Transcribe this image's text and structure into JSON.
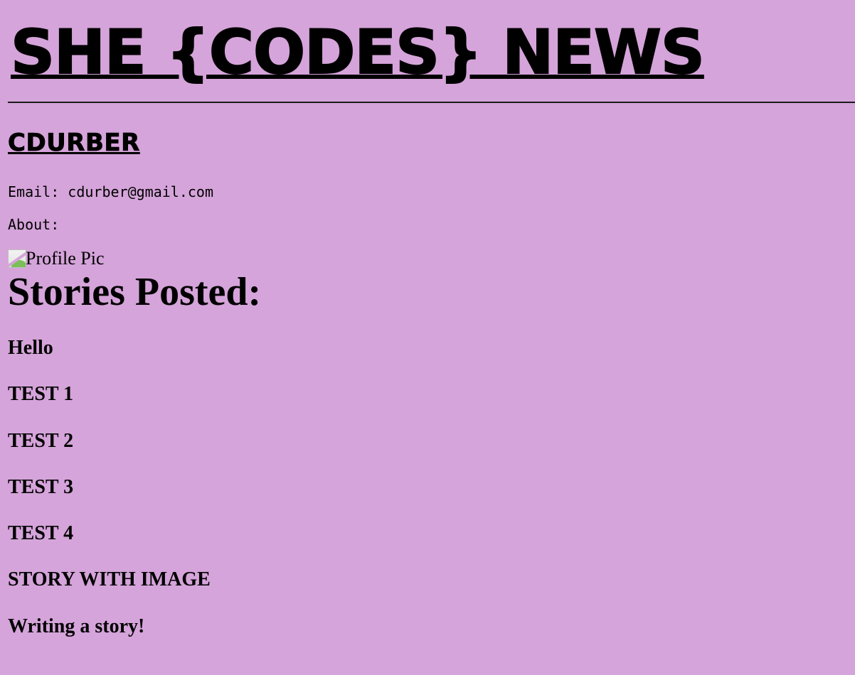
{
  "header": {
    "site_title": "SHE {CODES} NEWS"
  },
  "profile": {
    "username": "CDURBER",
    "email_line": "Email: cdurber@gmail.com",
    "about_line": "About:",
    "profile_pic_alt": "Profile Pic",
    "profile_pic_icon": "broken-image-icon"
  },
  "stories": {
    "heading": "Stories Posted:",
    "items": [
      {
        "title": "Hello"
      },
      {
        "title": "TEST 1"
      },
      {
        "title": "TEST 2"
      },
      {
        "title": "TEST 3"
      },
      {
        "title": "TEST 4"
      },
      {
        "title": "STORY WITH IMAGE"
      },
      {
        "title": "Writing a story!"
      }
    ]
  },
  "colors": {
    "background": "#d5a4da",
    "text": "#000000"
  }
}
